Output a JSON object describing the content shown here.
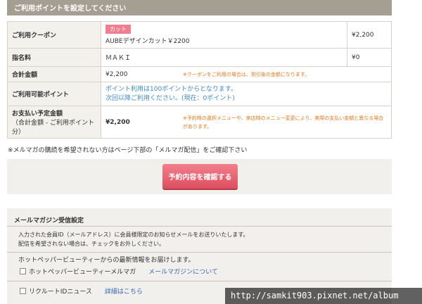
{
  "header": {
    "title": "ご利用ポイントを設定してください"
  },
  "rows": {
    "coupon": {
      "label": "ご利用クーポン",
      "badge": "カット",
      "name": "AUBEデザインカット￥2200",
      "price": "¥2,200"
    },
    "nomination": {
      "label": "指名料",
      "value": "ＭＡＫＩ",
      "price": "¥0"
    },
    "total": {
      "label": "合計金額",
      "value": "¥2,200",
      "note": "※クーポンをご利用の場合は、割引後の金額になります。"
    },
    "points": {
      "label": "ご利用可能ポイント",
      "line1": "ポイント利用は100ポイントからとなります。",
      "line2": "次回以降ご利用ください。(現在：0ポイント)"
    },
    "payment": {
      "label": "お支払い予定金額",
      "sublabel": "（合計金額 - ご利用ポイント分）",
      "value": "¥2,200",
      "note": "※予約時の選択メニューや、来店時のメニュー変更により、実際の支払い金額と異なる場合があります。"
    }
  },
  "mail_note": "※メルマガの購読を希望されない方はページ下部の「メルマガ配信」をご確認下さい",
  "confirm_button": "予約内容を確認する",
  "mailmag": {
    "title": "メールマガジン受信設定",
    "desc1": "入力された会員ID（メールアドレス）に会員様限定のお知らせメールをお送りいたします。",
    "desc2": "配信を希望されない場合は、チェックをお外しください。",
    "hpb_intro": "ホットペッパービューティーからの最新情報をお届けします。",
    "hpb_label": "ホットペッパービューティーメルマガ",
    "hpb_link": "メールマガジンについて",
    "recruit_label": "リクルートIDニュース",
    "recruit_link": "詳細はこちら"
  },
  "watermark": "http://samkit903.pixnet.net/album"
}
